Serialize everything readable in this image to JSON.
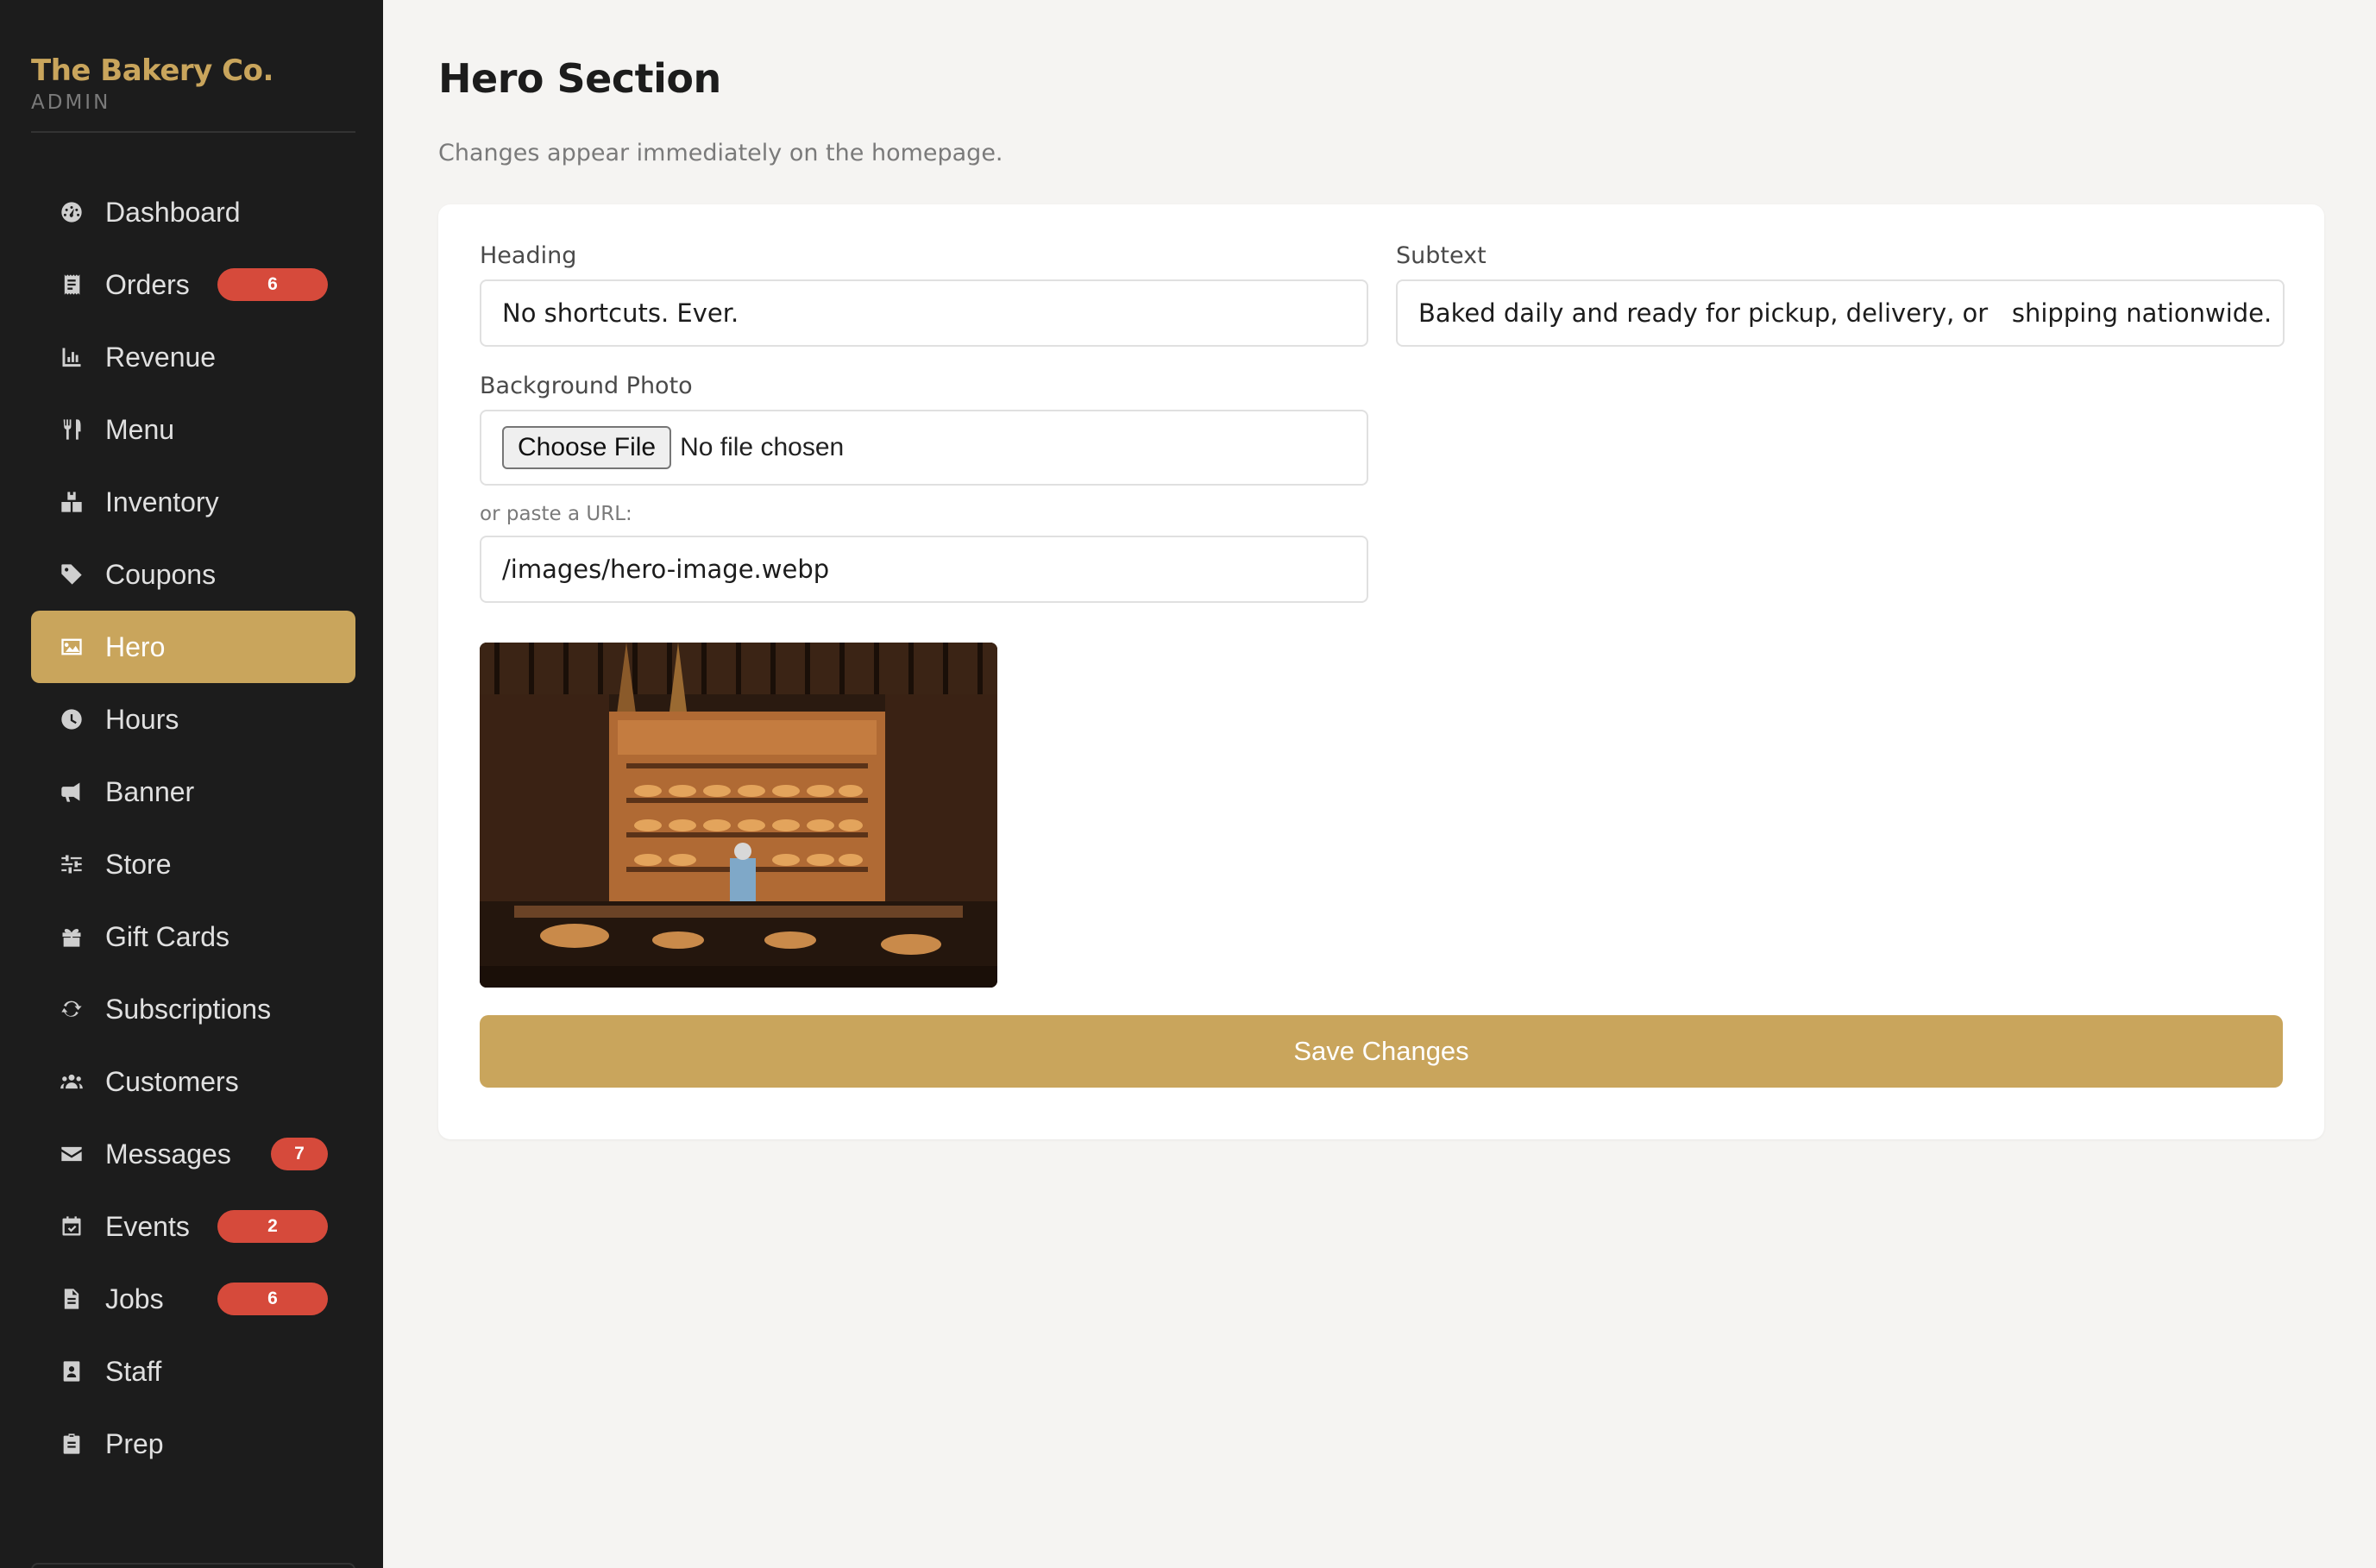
{
  "brand": {
    "name": "The Bakery Co.",
    "subtitle": "ADMIN"
  },
  "sidebar": {
    "items": [
      {
        "label": "Dashboard",
        "icon": "dashboard-icon"
      },
      {
        "label": "Orders",
        "icon": "receipt-icon",
        "badge": "6"
      },
      {
        "label": "Revenue",
        "icon": "chart-icon"
      },
      {
        "label": "Menu",
        "icon": "utensils-icon"
      },
      {
        "label": "Inventory",
        "icon": "boxes-icon"
      },
      {
        "label": "Coupons",
        "icon": "tag-icon"
      },
      {
        "label": "Hero",
        "icon": "image-icon",
        "active": true
      },
      {
        "label": "Hours",
        "icon": "clock-icon"
      },
      {
        "label": "Banner",
        "icon": "megaphone-icon"
      },
      {
        "label": "Store",
        "icon": "sliders-icon"
      },
      {
        "label": "Gift Cards",
        "icon": "gift-icon"
      },
      {
        "label": "Subscriptions",
        "icon": "refresh-icon"
      },
      {
        "label": "Customers",
        "icon": "users-icon"
      },
      {
        "label": "Messages",
        "icon": "envelope-icon",
        "badge": "7"
      },
      {
        "label": "Events",
        "icon": "calendar-icon",
        "badge": "2"
      },
      {
        "label": "Jobs",
        "icon": "document-icon",
        "badge": "6"
      },
      {
        "label": "Staff",
        "icon": "id-badge-icon"
      },
      {
        "label": "Prep",
        "icon": "clipboard-icon"
      }
    ]
  },
  "page": {
    "title": "Hero Section",
    "subtitle": "Changes appear immediately on the homepage."
  },
  "form": {
    "heading_label": "Heading",
    "heading_value": "No shortcuts. Ever.",
    "subtext_label": "Subtext",
    "subtext_value": "Baked daily and ready for pickup, delivery, or   shipping nationwide.",
    "photo_label": "Background Photo",
    "file_button": "Choose File",
    "file_status": "No file chosen",
    "url_label": "or paste a URL:",
    "url_value": "/images/hero-image.webp",
    "save_label": "Save Changes"
  },
  "colors": {
    "accent": "#c9a55c",
    "sidebar_bg": "#1c1c1c",
    "badge": "#d64a3b",
    "page_bg": "#f5f4f2"
  }
}
